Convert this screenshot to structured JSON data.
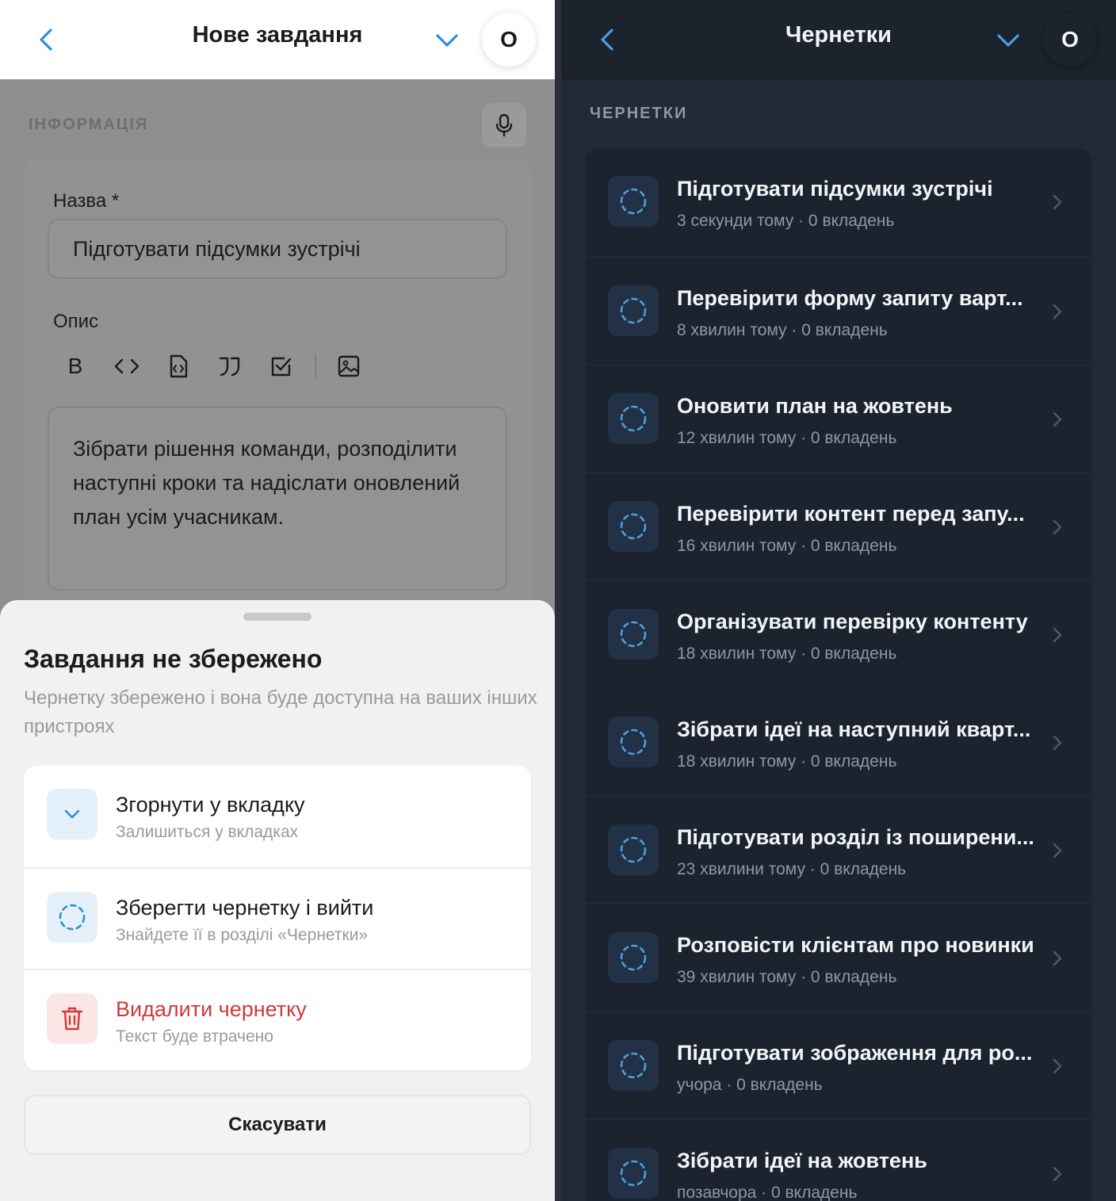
{
  "left": {
    "header": {
      "title": "Нове завдання",
      "avatar": "O"
    },
    "section": "ІНФОРМАЦІЯ",
    "name_label": "Назва *",
    "name_value": "Підготувати підсумки зустрічі",
    "desc_label": "Опис",
    "toolbar": [
      "bold-icon",
      "code-icon",
      "code-file-icon",
      "quote-icon",
      "checkbox-icon",
      "image-icon"
    ],
    "toolbar_bold": "B",
    "desc_value": "Зібрати рішення команди, розподілити наступні кроки та надіслати оновлений план усім учасникам.",
    "sheet": {
      "title": "Завдання не збережено",
      "subtitle": "Чернетку збережено і вона буде доступна на ваших інших пристроях",
      "options": [
        {
          "title": "Згорнути у вкладку",
          "subtitle": "Залишиться у вкладках",
          "icon": "chevron-down-icon",
          "color": "#1b1b1b"
        },
        {
          "title": "Зберегти чернетку і вийти",
          "subtitle": "Знайдете її в розділі «Чернетки»",
          "icon": "draft-circle-icon",
          "color": "#1b1b1b"
        },
        {
          "title": "Видалити чернетку",
          "subtitle": "Текст буде втрачено",
          "icon": "trash-icon",
          "color": "#d0393a"
        }
      ],
      "cancel": "Скасувати"
    }
  },
  "right": {
    "header": {
      "title": "Чернетки",
      "avatar": "O"
    },
    "section": "ЧЕРНЕТКИ",
    "drafts": [
      {
        "title": "Підготувати підсумки зустрічі",
        "subtitle": "3 секунди тому · 0 вкладень"
      },
      {
        "title": "Перевірити форму запиту варт...",
        "subtitle": "8 хвилин тому · 0 вкладень"
      },
      {
        "title": "Оновити план на жовтень",
        "subtitle": "12 хвилин тому · 0 вкладень"
      },
      {
        "title": "Перевірити контент перед запу...",
        "subtitle": "16 хвилин тому · 0 вкладень"
      },
      {
        "title": "Організувати перевірку контенту",
        "subtitle": "18 хвилин тому · 0 вкладень"
      },
      {
        "title": "Зібрати ідеї на наступний кварт...",
        "subtitle": "18 хвилин тому · 0 вкладень"
      },
      {
        "title": "Підготувати розділ із поширени...",
        "subtitle": "23 хвилини тому · 0 вкладень"
      },
      {
        "title": "Розповісти клієнтам про новинки",
        "subtitle": "39 хвилин тому · 0 вкладень"
      },
      {
        "title": "Підготувати зображення для ро...",
        "subtitle": "учора · 0 вкладень"
      },
      {
        "title": "Зібрати ідеї на жовтень",
        "subtitle": "позавчора · 0 вкладень"
      }
    ]
  },
  "colors": {
    "accent": "#2f8fd6",
    "accent_dark": "#4a9fe0",
    "danger": "#d0393a"
  }
}
